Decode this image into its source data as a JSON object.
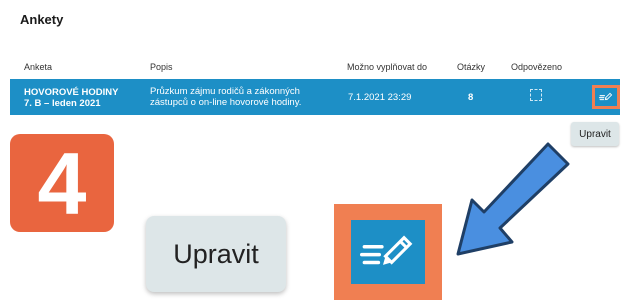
{
  "page": {
    "title": "Ankety"
  },
  "table": {
    "headers": {
      "anketa": "Anketa",
      "popis": "Popis",
      "deadline": "Možno vyplňovat do",
      "questions": "Otázky",
      "answered": "Odpovězeno"
    },
    "rows": [
      {
        "name_line1": "HOVOROVÉ HODINY",
        "name_line2": "7. B – leden 2021",
        "desc_line1": "Průzkum zájmu rodičů a zákonných",
        "desc_line2": "zástupců o on-line hovorové hodiny.",
        "deadline": "7.1.2021 23:29",
        "questions": "8",
        "answered": false,
        "edit_icon": "edit-form-pencil-icon"
      }
    ]
  },
  "tooltip": {
    "label": "Upravit"
  },
  "callout": {
    "step_number": "4",
    "zoom_tooltip_label": "Upravit",
    "zoom_button_icon": "edit-form-pencil-icon",
    "arrow_icon": "arrow-down-left-icon"
  },
  "colors": {
    "row_bg": "#1d8fc6",
    "edit_button_frame": "#f07f52",
    "step_badge": "#e9653f",
    "arrow": "#4a8fe0",
    "tooltip_bg": "#dde6e8"
  }
}
